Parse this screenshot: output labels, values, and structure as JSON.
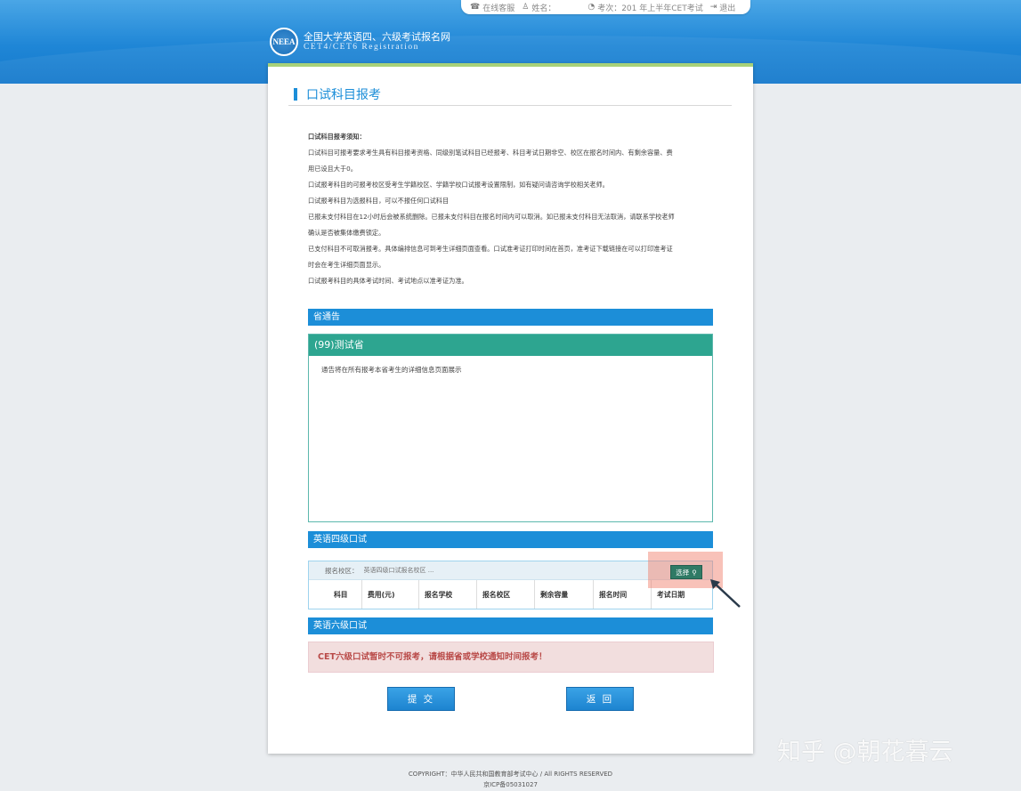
{
  "topbar": {
    "service": "在线客服",
    "name_label": "姓名：",
    "exam_label": "考次：201  年上半年CET考试",
    "logout": "退出"
  },
  "logo": {
    "emblem": "NEEA",
    "line1": "全国大学英语四、六级考试报名网",
    "line2": "CET4/CET6  Registration"
  },
  "page": {
    "title": "口试科目报考"
  },
  "notice": {
    "heading": "口试科目报考须知：",
    "lines": [
      "口试科目可报考要求考生具有科目报考资格、同级别笔试科目已经报考、科目考试日期非空、校区在报名时间内、有剩余容量、费",
      "用已设且大于0。",
      "口试报考科目的可报考校区受考生学籍校区、学籍学校口试报考设置限制，如有疑问请咨询学校相关老师。",
      "口试报考科目为选报科目，可以不报任何口试科目",
      "已报未支付科目在12小时后会被系统删除。已报未支付科目在报名时间内可以取消。如已报未支付科目无法取消，请联系学校老师",
      "确认是否被集体缴费锁定。",
      "已支付科目不可取消报考。具体编排信息可到考生详细页面查看。口试准考证打印时间在首页，准考证下载链接在可以打印准考证",
      "时会在考生详细页面显示。",
      "口试报考科目的具体考试时间、考试地点以准考证为准。"
    ]
  },
  "province": {
    "section_title": "省通告",
    "name": "(99)测试省",
    "content": "通告将在所有报考本省考生的详细信息页面展示"
  },
  "cet4": {
    "section_title": "英语四级口试",
    "campus_label": "报名校区：",
    "campus_placeholder": "英语四级口试报名校区 ...",
    "select_label": "选择",
    "columns": [
      "科目",
      "费用(元)",
      "报名学校",
      "报名校区",
      "剩余容量",
      "报名时间",
      "考试日期"
    ]
  },
  "cet6": {
    "section_title": "英语六级口试",
    "message": "CET六级口试暂时不可报考，请根据省或学校通知时间报考！"
  },
  "buttons": {
    "submit": "提 交",
    "back": "返 回"
  },
  "footer": {
    "copyright": "COPYRIGHT：中华人民共和国教育部考试中心 / All RIGHTS RESERVED",
    "icp": "京ICP备05031027"
  },
  "watermark": "知乎 @朝花暮云",
  "colors": {
    "brand_blue": "#1c8ed8",
    "teal": "#2da590",
    "error_text": "#b94a48",
    "highlight": "#f07864"
  }
}
